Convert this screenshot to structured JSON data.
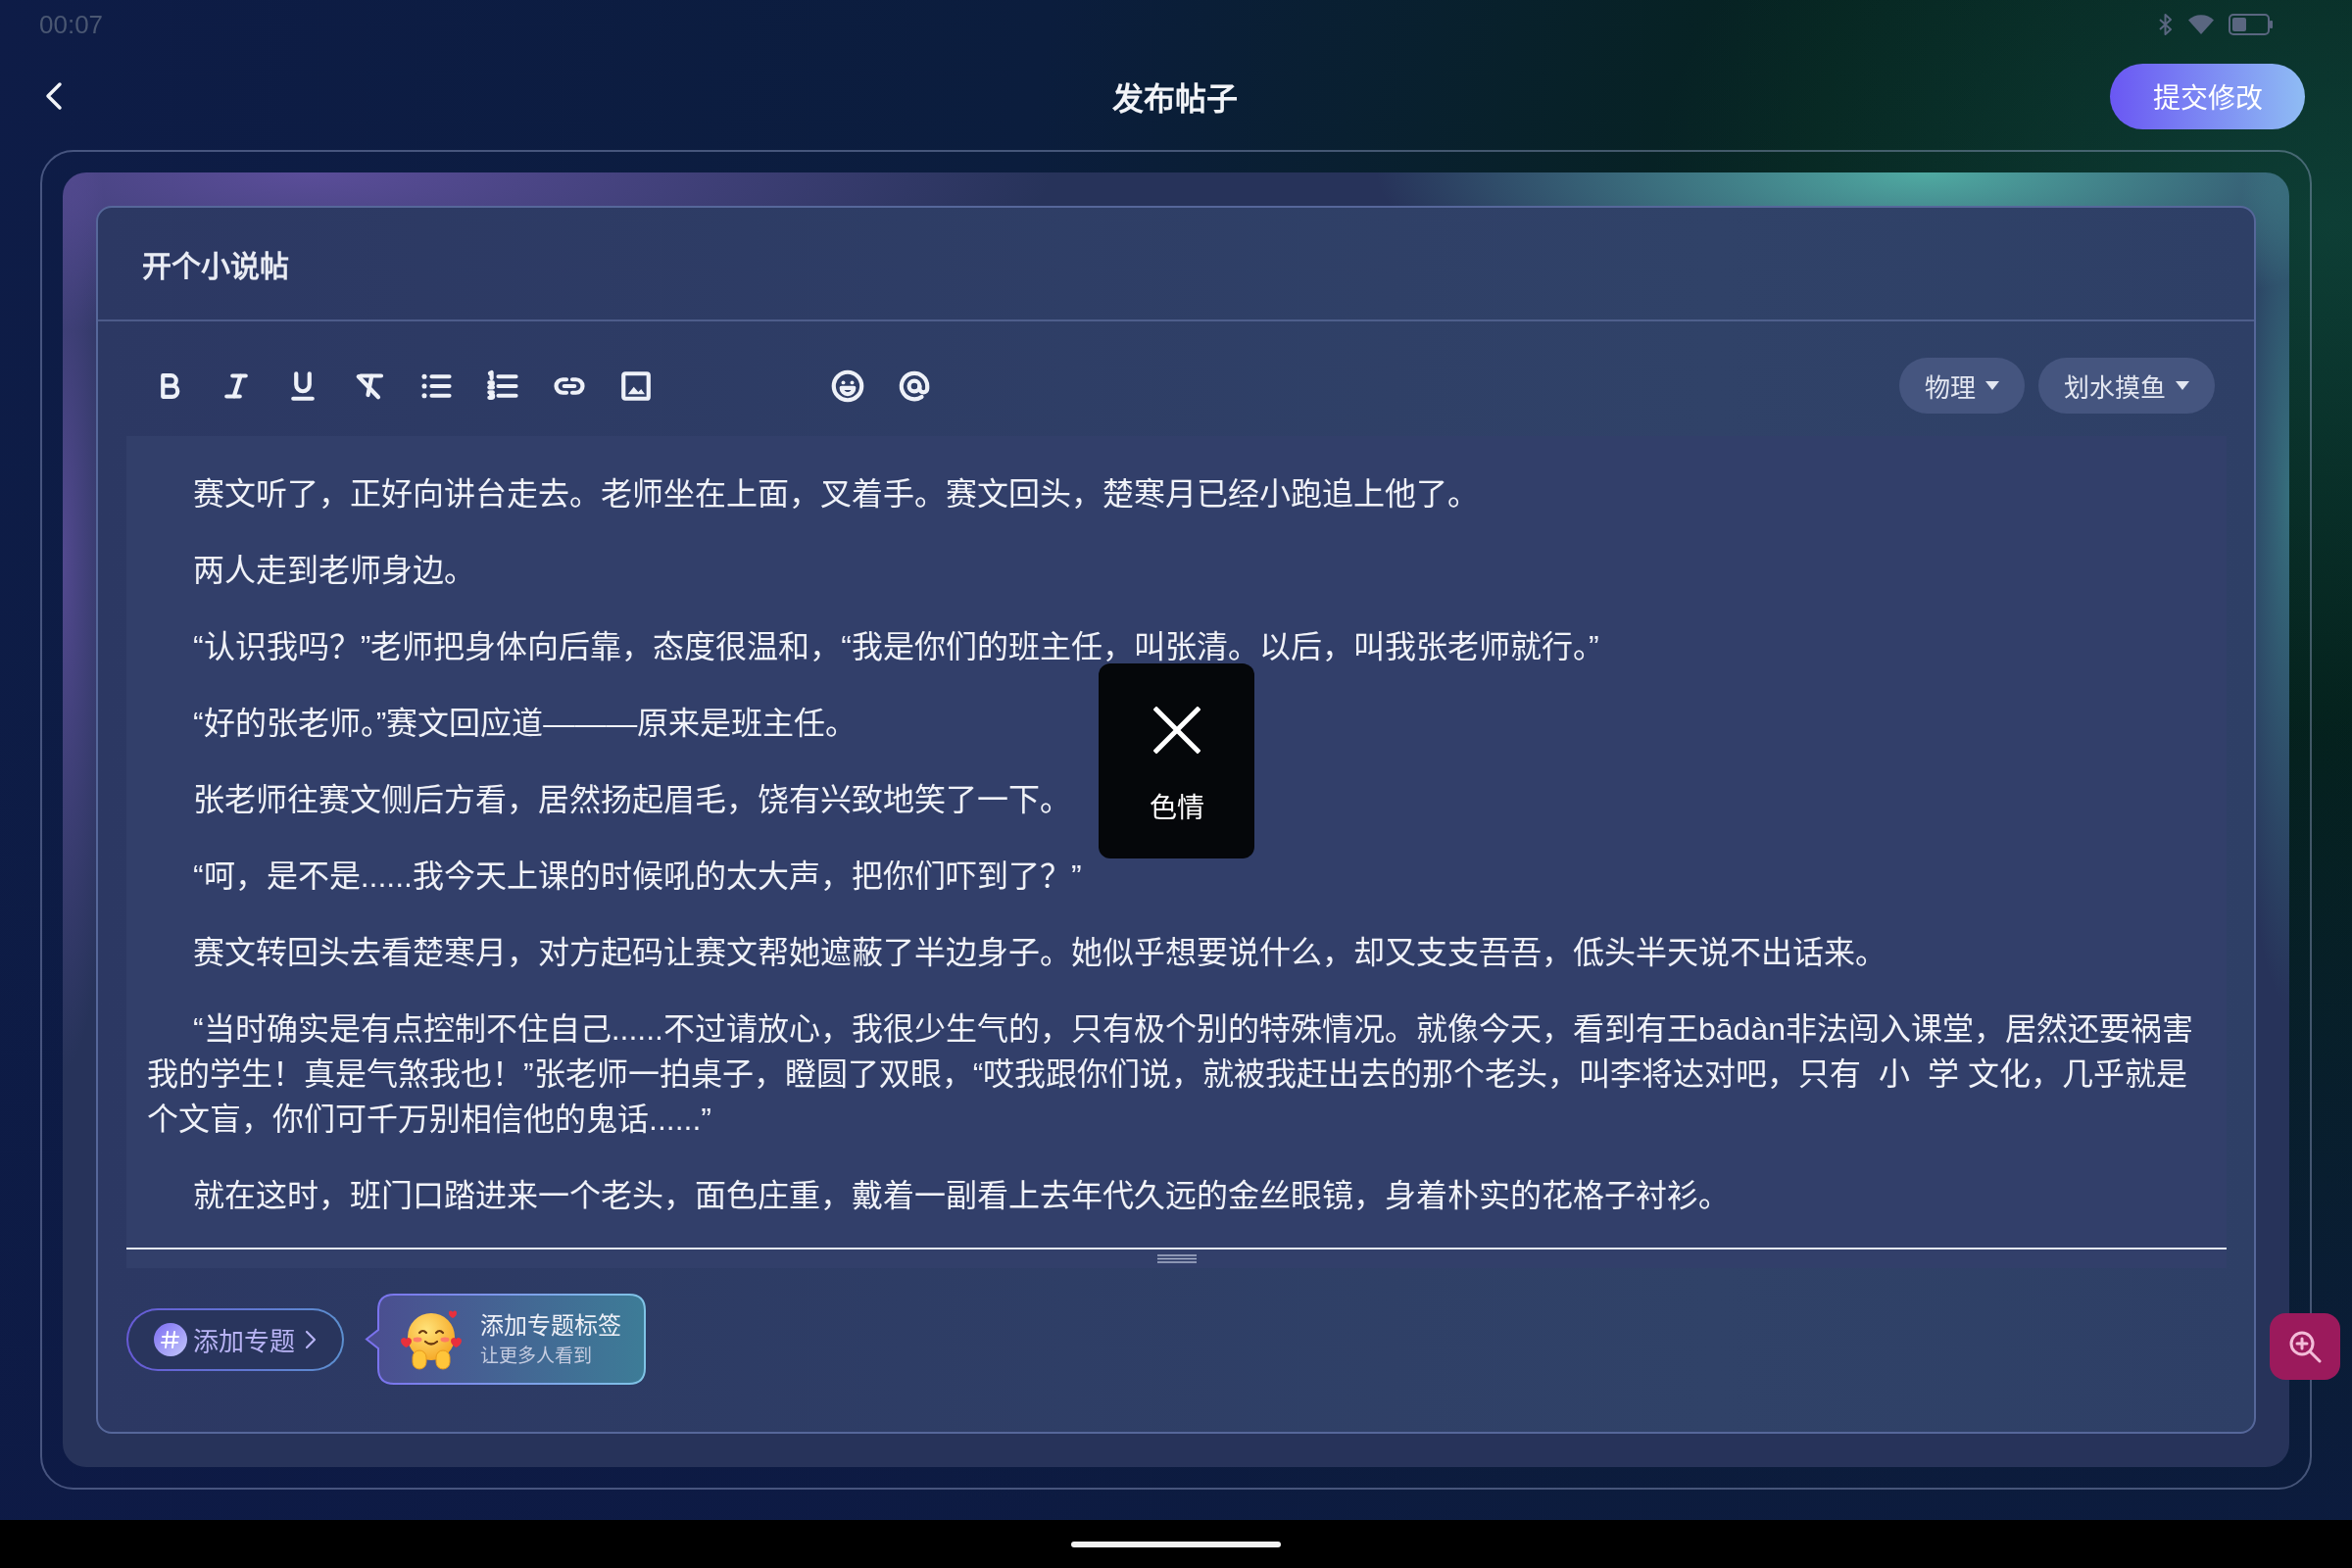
{
  "status_bar": {
    "time": "00:07"
  },
  "header": {
    "title": "发布帖子",
    "submit_button": "提交修改"
  },
  "editor": {
    "title_field": {
      "value": "开个小说帖"
    },
    "tag_dropdowns": [
      {
        "label": "物理"
      },
      {
        "label": "划水摸鱼"
      }
    ],
    "paragraphs": [
      "赛文听了，正好向讲台走去。老师坐在上面，叉着手。赛文回头，楚寒月已经小跑追上他了。",
      "两人走到老师身边。",
      "“认识我吗？”老师把身体向后靠，态度很温和，“我是你们的班主任，叫张清。以后，叫我张老师就行。”",
      "“好的张老师。”赛文回应道———原来是班主任。",
      "张老师往赛文侧后方看，居然扬起眉毛，饶有兴致地笑了一下。",
      "“呵，是不是......我今天上课的时候吼的太大声，把你们吓到了？”",
      "赛文转回头去看楚寒月，对方起码让赛文帮她遮蔽了半边身子。她似乎想要说什么，却又支支吾吾，低头半天说不出话来。",
      "“当时确实是有点控制不住自己......不过请放心，我很少生气的，只有极个别的特殊情况。就像今天，看到有王bādàn非法闯入课堂，居然还要祸害我的学生！真是气煞我也！”张老师一拍桌子，瞪圆了双眼，“哎我跟你们说，就被我赶出去的那个老头，叫李将达对吧，只有  小  学 文化，几乎就是个文盲，你们可千万别相信他的鬼话......”",
      "就在这时，班门口踏进来一个老头，面色庄重，戴着一副看上去年代久远的金丝眼镜，身着朴实的花格子衬衫。"
    ],
    "add_topic_button": "添加专题",
    "topic_tip": {
      "title": "添加专题标签",
      "subtitle": "让更多人看到"
    }
  },
  "review_toast": {
    "label": "色情"
  }
}
